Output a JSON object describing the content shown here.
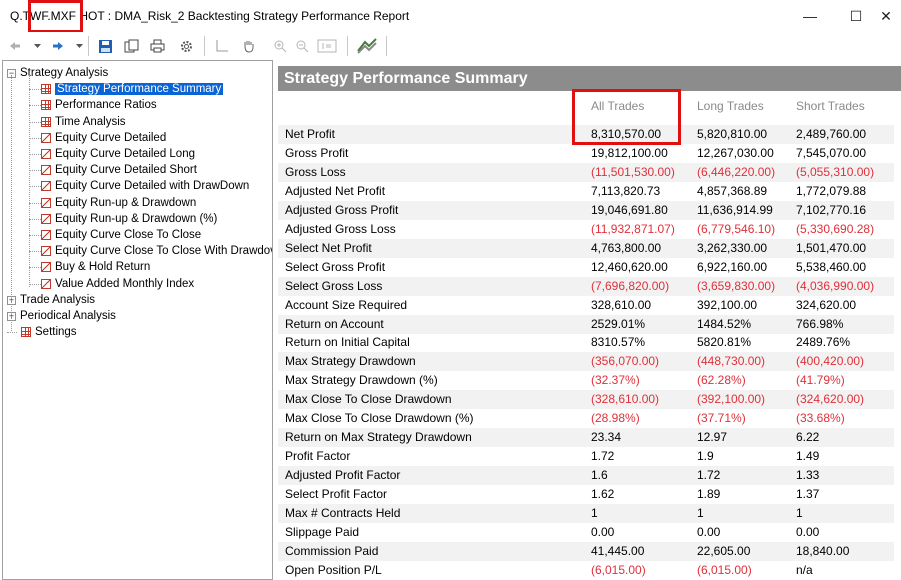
{
  "window": {
    "title": "Q.TWF.MXF HOT : DMA_Risk_2 Backtesting Strategy Performance Report",
    "minimize_glyph": "—",
    "maximize_glyph": "☐",
    "close_glyph": "✕"
  },
  "toolbar": {
    "icons": [
      "back-arrow-icon",
      "dropdown-icon",
      "forward-arrow-icon",
      "dropdown-icon",
      "save-icon",
      "copy-icon",
      "print-icon",
      "settings-gear-icon",
      "crosshair-icon",
      "hand-pan-icon",
      "zoom-in-icon",
      "zoom-out-icon",
      "zoom-fit-icon",
      "chart-style-icon"
    ]
  },
  "tree": {
    "items": [
      {
        "label": "Strategy Analysis",
        "level": 0,
        "expander": "−"
      },
      {
        "label": "Strategy Performance Summary",
        "level": 1,
        "icon": "grid",
        "selected": true
      },
      {
        "label": "Performance Ratios",
        "level": 1,
        "icon": "grid"
      },
      {
        "label": "Time Analysis",
        "level": 1,
        "icon": "grid"
      },
      {
        "label": "Equity Curve Detailed",
        "level": 1,
        "icon": "chart"
      },
      {
        "label": "Equity Curve Detailed Long",
        "level": 1,
        "icon": "chart"
      },
      {
        "label": "Equity Curve Detailed Short",
        "level": 1,
        "icon": "chart"
      },
      {
        "label": "Equity Curve Detailed with DrawDown",
        "level": 1,
        "icon": "chart"
      },
      {
        "label": "Equity Run-up & Drawdown",
        "level": 1,
        "icon": "chart"
      },
      {
        "label": "Equity Run-up & Drawdown (%)",
        "level": 1,
        "icon": "chart"
      },
      {
        "label": "Equity Curve Close To Close",
        "level": 1,
        "icon": "chart"
      },
      {
        "label": "Equity Curve Close To Close With Drawdov",
        "level": 1,
        "icon": "chart"
      },
      {
        "label": "Buy & Hold Return",
        "level": 1,
        "icon": "chart"
      },
      {
        "label": "Value Added Monthly Index",
        "level": 1,
        "icon": "chart"
      },
      {
        "label": "Trade Analysis",
        "level": 0,
        "expander": "+"
      },
      {
        "label": "Periodical Analysis",
        "level": 0,
        "expander": "+"
      },
      {
        "label": "Settings",
        "level": 0,
        "icon": "grid"
      }
    ]
  },
  "report": {
    "title": "Strategy Performance Summary",
    "columns": [
      "All Trades",
      "Long Trades",
      "Short Trades"
    ],
    "rows": [
      {
        "label": "Net Profit",
        "all": "8,310,570.00",
        "long": "5,820,810.00",
        "short": "2,489,760.00"
      },
      {
        "label": "Gross Profit",
        "all": "19,812,100.00",
        "long": "12,267,030.00",
        "short": "7,545,070.00"
      },
      {
        "label": "Gross Loss",
        "all": "(11,501,530.00)",
        "long": "(6,446,220.00)",
        "short": "(5,055,310.00)"
      },
      {
        "label": "Adjusted Net Profit",
        "all": "7,113,820.73",
        "long": "4,857,368.89",
        "short": "1,772,079.88"
      },
      {
        "label": "Adjusted Gross Profit",
        "all": "19,046,691.80",
        "long": "11,636,914.99",
        "short": "7,102,770.16"
      },
      {
        "label": "Adjusted Gross Loss",
        "all": "(11,932,871.07)",
        "long": "(6,779,546.10)",
        "short": "(5,330,690.28)"
      },
      {
        "label": "Select Net Profit",
        "all": "4,763,800.00",
        "long": "3,262,330.00",
        "short": "1,501,470.00"
      },
      {
        "label": "Select Gross Profit",
        "all": "12,460,620.00",
        "long": "6,922,160.00",
        "short": "5,538,460.00"
      },
      {
        "label": "Select Gross Loss",
        "all": "(7,696,820.00)",
        "long": "(3,659,830.00)",
        "short": "(4,036,990.00)"
      },
      {
        "label": "Account Size Required",
        "all": "328,610.00",
        "long": "392,100.00",
        "short": "324,620.00"
      },
      {
        "label": "Return on Account",
        "all": "2529.01%",
        "long": "1484.52%",
        "short": "766.98%"
      },
      {
        "label": "Return on Initial Capital",
        "all": "8310.57%",
        "long": "5820.81%",
        "short": "2489.76%"
      },
      {
        "label": "Max Strategy Drawdown",
        "all": "(356,070.00)",
        "long": "(448,730.00)",
        "short": "(400,420.00)"
      },
      {
        "label": "Max Strategy Drawdown (%)",
        "all": "(32.37%)",
        "long": "(62.28%)",
        "short": "(41.79%)"
      },
      {
        "label": "Max Close To Close Drawdown",
        "all": "(328,610.00)",
        "long": "(392,100.00)",
        "short": "(324,620.00)"
      },
      {
        "label": "Max Close To Close Drawdown (%)",
        "all": "(28.98%)",
        "long": "(37.71%)",
        "short": "(33.68%)"
      },
      {
        "label": "Return on Max Strategy Drawdown",
        "all": "23.34",
        "long": "12.97",
        "short": "6.22"
      },
      {
        "label": "Profit Factor",
        "all": "1.72",
        "long": "1.9",
        "short": "1.49"
      },
      {
        "label": "Adjusted Profit Factor",
        "all": "1.6",
        "long": "1.72",
        "short": "1.33"
      },
      {
        "label": "Select Profit Factor",
        "all": "1.62",
        "long": "1.89",
        "short": "1.37"
      },
      {
        "label": "Max # Contracts Held",
        "all": "1",
        "long": "1",
        "short": "1"
      },
      {
        "label": "Slippage Paid",
        "all": "0.00",
        "long": "0.00",
        "short": "0.00"
      },
      {
        "label": "Commission Paid",
        "all": "41,445.00",
        "long": "22,605.00",
        "short": "18,840.00"
      },
      {
        "label": "Open Position P/L",
        "all": "(6,015.00)",
        "long": "(6,015.00)",
        "short": "n/a"
      }
    ]
  },
  "colors": {
    "negative_value": "#e0303a",
    "header_bg": "#8c8c8c",
    "selection_bg": "#0a64d6",
    "highlight_box": "#e01010"
  }
}
